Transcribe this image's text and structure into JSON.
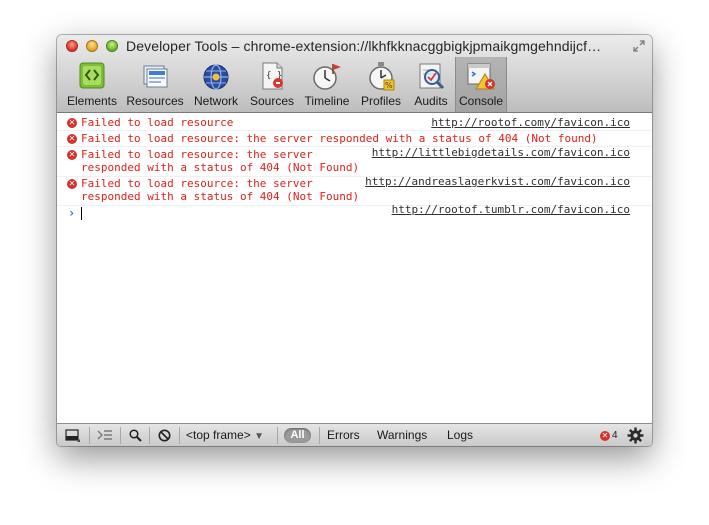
{
  "window": {
    "title": "Developer Tools – chrome-extension://lkhfkknacggbigkjpmaikgmgehndijcf…"
  },
  "toolbar": {
    "tabs": [
      {
        "label": "Elements",
        "icon": "elements-icon"
      },
      {
        "label": "Resources",
        "icon": "resources-icon"
      },
      {
        "label": "Network",
        "icon": "network-icon"
      },
      {
        "label": "Sources",
        "icon": "sources-icon"
      },
      {
        "label": "Timeline",
        "icon": "timeline-icon"
      },
      {
        "label": "Profiles",
        "icon": "profiles-icon"
      },
      {
        "label": "Audits",
        "icon": "audits-icon"
      },
      {
        "label": "Console",
        "icon": "console-icon"
      }
    ],
    "selected": "Console"
  },
  "console": {
    "messages": [
      {
        "level": "error",
        "text": "Failed to load resource",
        "url": "http://rootof.comy/favicon.ico"
      },
      {
        "level": "error",
        "text": "Failed to load resource: the server responded with a status of 404 (Not found)",
        "url": ""
      },
      {
        "level": "error",
        "text": "Failed to load resource: the server\nresponded with a status of 404 (Not Found)",
        "url": "http://littlebigdetails.com/favicon.ico"
      },
      {
        "level": "error",
        "text": "Failed to load resource: the server\nresponded with a status of 404 (Not Found)",
        "url": "http://andreaslagerkvist.com/favicon.ico"
      },
      {
        "level": "prompt",
        "text": "",
        "url": "http://rootof.tumblr.com/favicon.ico"
      }
    ],
    "prompt_symbol": "›",
    "error_icon_glyph": "✕"
  },
  "statusbar": {
    "frame_select": "<top frame>",
    "filters": {
      "all": "All",
      "errors": "Errors",
      "warnings": "Warnings",
      "logs": "Logs"
    },
    "error_count": "4"
  },
  "colors": {
    "error_text": "#e0211a",
    "error_icon": "#d6312b",
    "prompt": "#2f71c7"
  }
}
